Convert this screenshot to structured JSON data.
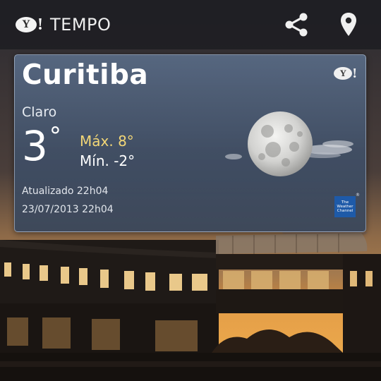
{
  "header": {
    "logo_letter": "Y",
    "logo_bang": "!",
    "title": "TEMPO",
    "actions": [
      {
        "icon": "share-icon"
      },
      {
        "icon": "location-pin-icon"
      }
    ]
  },
  "weather": {
    "city": "Curitiba",
    "condition": "Claro",
    "temperature": "3",
    "temperature_unit": "°",
    "max": "Máx. 8°",
    "min": "Mín. -2°",
    "updated": "Atualizado 22h04",
    "date": "23/07/2013 22h04",
    "condition_icon": "moon-clear-night-icon",
    "provider_logo": [
      "The",
      "Weather",
      "Channel"
    ],
    "provider_reg": "®",
    "badge_letter": "Y",
    "badge_bang": "!"
  },
  "colors": {
    "topbar_bg": "#1e1e22",
    "card_bg": "#4f6384",
    "max_temp": "#f2d677",
    "text": "#ffffff",
    "provider": "#1e5aa8"
  }
}
